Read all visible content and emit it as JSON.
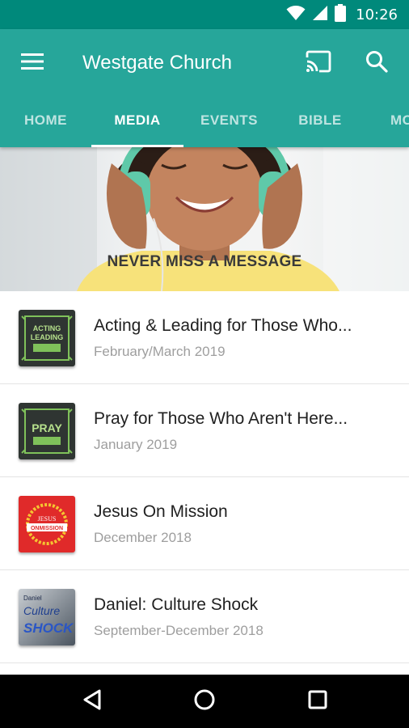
{
  "status_bar": {
    "time": "10:26",
    "icons": [
      "wifi-icon",
      "cell-signal-icon",
      "battery-icon"
    ]
  },
  "app_bar": {
    "title": "Westgate Church",
    "icons": [
      "menu-icon",
      "cast-icon",
      "search-icon"
    ]
  },
  "tabs": [
    {
      "label": "HOME",
      "active": false
    },
    {
      "label": "MEDIA",
      "active": true
    },
    {
      "label": "EVENTS",
      "active": false
    },
    {
      "label": "BIBLE",
      "active": false
    },
    {
      "label": "MO",
      "active": false
    }
  ],
  "banner": {
    "caption": "NEVER MISS A MESSAGE"
  },
  "series": [
    {
      "title": "Acting & Leading for Those Who...",
      "date": "February/March 2019",
      "artwork_text": [
        "ACTING",
        "LEADING"
      ]
    },
    {
      "title": "Pray for Those Who Aren't Here...",
      "date": "January 2019",
      "artwork_text": [
        "PRAY"
      ]
    },
    {
      "title": "Jesus On Mission",
      "date": "December 2018",
      "artwork_text": [
        "JESUS",
        "ONMISSION"
      ]
    },
    {
      "title": "Daniel: Culture Shock",
      "date": "September-December 2018",
      "artwork_text": [
        "Daniel",
        "Culture",
        "SHOCK"
      ]
    }
  ],
  "navigation": [
    "back-icon",
    "home-icon",
    "recents-icon"
  ],
  "colors": {
    "status_bar": "#00897b",
    "app_bar": "#26a69a",
    "accent": "#ffffff"
  }
}
